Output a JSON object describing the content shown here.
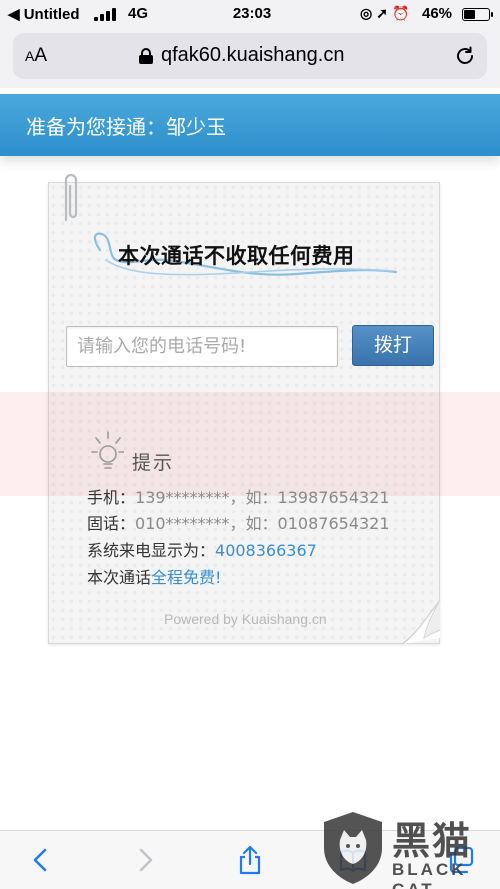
{
  "status_bar": {
    "back_app": "◀ Untitled",
    "network": "4G",
    "time": "23:03",
    "icons": "◎➚⏰",
    "battery_percent": "46%",
    "battery_level": 0.46
  },
  "browser": {
    "text_size_label": "AA",
    "url": "qfak60.kuaishang.cn",
    "icons": [
      "lock-icon",
      "reload-icon"
    ]
  },
  "banner": {
    "text": "准备为您接通：邹少玉",
    "background": "#3a9cd4"
  },
  "card": {
    "title": "本次通话不收取任何费用",
    "phone_placeholder": "请输入您的电话号码!",
    "dial_label": "拨打",
    "tip_label": "提示",
    "lines": [
      {
        "label": "手机：",
        "value": "139********，如：13987654321"
      },
      {
        "label": "固话：",
        "value": "010********，如：01087654321"
      },
      {
        "label": "系统来电显示为：",
        "value": "4008366367"
      },
      {
        "label": "本次通话",
        "value": "全程免费!"
      }
    ],
    "powered_by": "Powered by Kuaishang.cn",
    "accent_color": "#3b8fd0"
  },
  "toolbar": {
    "icons": [
      "back-icon",
      "forward-icon",
      "share-icon",
      "bookmarks-icon",
      "tabs-icon"
    ]
  },
  "watermark": {
    "han": "黑猫",
    "latin": "BLACK CAT"
  }
}
